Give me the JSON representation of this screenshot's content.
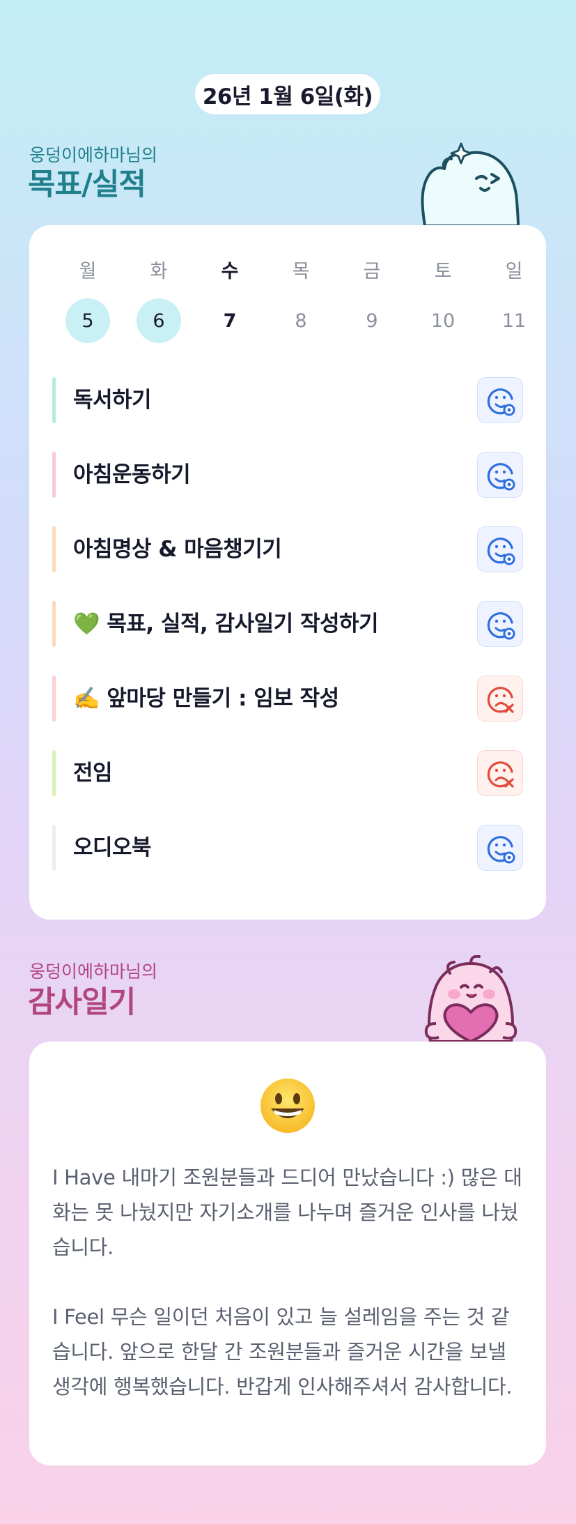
{
  "header": {
    "date": "26년 1월 6일(화)"
  },
  "goals_section": {
    "subtitle": "웅덩이에하마님의",
    "title": "목표/실적"
  },
  "week": {
    "days": [
      "월",
      "화",
      "수",
      "목",
      "금",
      "토",
      "일"
    ],
    "dates": [
      "5",
      "6",
      "7",
      "8",
      "9",
      "10",
      "11"
    ],
    "completed_dates": [
      "5",
      "6"
    ],
    "today": "7"
  },
  "goals": [
    {
      "label": "독서하기",
      "status": "achieved",
      "bar_color": "#b6ecd9",
      "icon": "smile-check-icon"
    },
    {
      "label": "아침운동하기",
      "status": "achieved",
      "bar_color": "#f9c8de",
      "icon": "smile-check-icon"
    },
    {
      "label": "아침명상 & 마음챙기기",
      "status": "achieved",
      "bar_color": "#fcd9b8",
      "icon": "smile-check-icon"
    },
    {
      "label": "💚 목표, 실적, 감사일기 작성하기",
      "status": "achieved",
      "bar_color": "#fcd9b8",
      "icon": "smile-check-icon"
    },
    {
      "label": "✍️ 앞마당 만들기 : 임보 작성",
      "status": "missed",
      "bar_color": "#fbd0d0",
      "icon": "sad-x-icon"
    },
    {
      "label": "전임",
      "status": "missed",
      "bar_color": "#d7f3b3",
      "icon": "sad-x-icon"
    },
    {
      "label": "오디오북",
      "status": "achieved",
      "bar_color": "#eeeeee",
      "icon": "smile-check-icon"
    }
  ],
  "gratitude_section": {
    "subtitle": "웅덩이에하마님의",
    "title": "감사일기"
  },
  "diary": {
    "mood_icon": "grinning-face-icon",
    "paragraphs": [
      "I Have 내마기 조원분들과 드디어 만났습니다 :) 많은 대화는 못 나눴지만 자기소개를 나누며 즐거운 인사를 나눴습니다.",
      "I Feel 무슨 일이던 처음이 있고 늘 설레임을 주는 것 같습니다. 앞으로 한달 간 조원분들과 즐거운 시간을 보낼 생각에 행복했습니다. 반갑게 인사해주셔서 감사합니다."
    ]
  },
  "colors": {
    "teal_title": "#1f7f8a",
    "pink_title": "#b1457f",
    "achieved_blue": "#2f6fe0",
    "missed_red": "#e24b3b"
  }
}
